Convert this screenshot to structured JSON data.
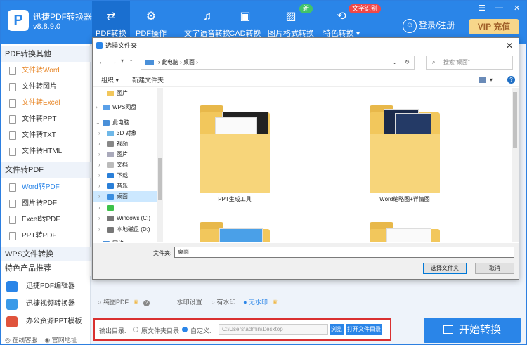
{
  "app": {
    "name": "迅捷PDF转换器",
    "version": "v8.8.9.0",
    "logo_letter": "P",
    "accent": "#2a85e8"
  },
  "nav": {
    "tabs": [
      {
        "label": "PDF转换",
        "icon": "pdf-convert-icon",
        "glyph": "⇄",
        "active": true
      },
      {
        "label": "PDF操作",
        "icon": "gear-icon",
        "glyph": "⚙"
      },
      {
        "label": "文字语音转换",
        "icon": "audio-wave-icon",
        "glyph": "♫"
      },
      {
        "label": "CAD转换",
        "icon": "cad-icon",
        "glyph": "▣"
      },
      {
        "label": "图片格式转换",
        "icon": "image-icon",
        "glyph": "▨",
        "badge": "新"
      },
      {
        "label": "特色转换 ▾",
        "icon": "special-convert-icon",
        "glyph": "⟲",
        "badge": "文字识别"
      }
    ],
    "login": "登录/注册",
    "vip": "VIP 充值",
    "window_controls": [
      "☰",
      "—",
      "✕"
    ]
  },
  "sidebar": {
    "sections": [
      {
        "title": "PDF转换其他",
        "items": [
          {
            "label": "文件转Word",
            "style": "orange"
          },
          {
            "label": "文件转图片",
            "style": ""
          },
          {
            "label": "文件转Excel",
            "style": "orange"
          },
          {
            "label": "文件转PPT",
            "style": ""
          },
          {
            "label": "文件转TXT",
            "style": ""
          },
          {
            "label": "文件转HTML",
            "style": ""
          }
        ]
      },
      {
        "title": "文件转PDF",
        "items": [
          {
            "label": "Word转PDF",
            "style": "blue"
          },
          {
            "label": "图片转PDF",
            "style": ""
          },
          {
            "label": "Excel转PDF",
            "style": ""
          },
          {
            "label": "PPT转PDF",
            "style": ""
          }
        ]
      },
      {
        "title": "WPS文件转换",
        "items": []
      },
      {
        "title": "特色产品推荐",
        "items": [
          {
            "label": "迅捷PDF编辑器",
            "style": "prod",
            "color": "#2a85e8"
          },
          {
            "label": "迅捷视频转换器",
            "style": "prod",
            "color": "#2a85e8"
          },
          {
            "label": "办公资源PPT模板",
            "style": "prod",
            "color": "#e0533c"
          }
        ]
      }
    ],
    "footer": [
      "在线客服",
      "官网地址"
    ]
  },
  "options": {
    "pure_pdf": "纯图PDF",
    "watermark_label": "水印设置:",
    "with_watermark": "有水印",
    "no_watermark": "无水印"
  },
  "output": {
    "label": "输出目录:",
    "original": "原文件夹目录",
    "custom": "自定义:",
    "path_placeholder": "C:\\Users\\admin\\Desktop",
    "browse": "浏览",
    "open": "打开文件目录"
  },
  "start_button": "开始转换",
  "dialog": {
    "title": "选择文件夹",
    "breadcrumb": "›  此电脑  ›  桌面  ›",
    "search_placeholder": "搜索\"桌面\"",
    "organize": "组织 ▾",
    "new_folder": "新建文件夹",
    "tree": [
      {
        "label": "图片",
        "indent": 1,
        "icon": "folder"
      },
      {
        "label": "WPS网盘",
        "indent": 0,
        "icon": "cloud"
      },
      {
        "label": "此电脑",
        "indent": 0,
        "icon": "pc"
      },
      {
        "label": "3D 对象",
        "indent": 1,
        "icon": "3d"
      },
      {
        "label": "视频",
        "indent": 1,
        "icon": "video"
      },
      {
        "label": "图片",
        "indent": 1,
        "icon": "folder"
      },
      {
        "label": "文档",
        "indent": 1,
        "icon": "doc"
      },
      {
        "label": "下载",
        "indent": 1,
        "icon": "download"
      },
      {
        "label": "音乐",
        "indent": 1,
        "icon": "music"
      },
      {
        "label": "桌面",
        "indent": 1,
        "icon": "desktop",
        "selected": true
      },
      {
        "label": "",
        "indent": 1,
        "icon": "green"
      },
      {
        "label": "Windows (C:)",
        "indent": 1,
        "icon": "drive"
      },
      {
        "label": "本地磁盘 (D:)",
        "indent": 1,
        "icon": "drive"
      },
      {
        "label": "网络",
        "indent": 0,
        "icon": "network"
      }
    ],
    "folders": [
      {
        "label": "PPT生成工具"
      },
      {
        "label": "Word缩略图+详情图"
      }
    ],
    "filename_label": "文件夹:",
    "filename_value": "桌面",
    "select_button": "选择文件夹",
    "cancel_button": "取消"
  }
}
